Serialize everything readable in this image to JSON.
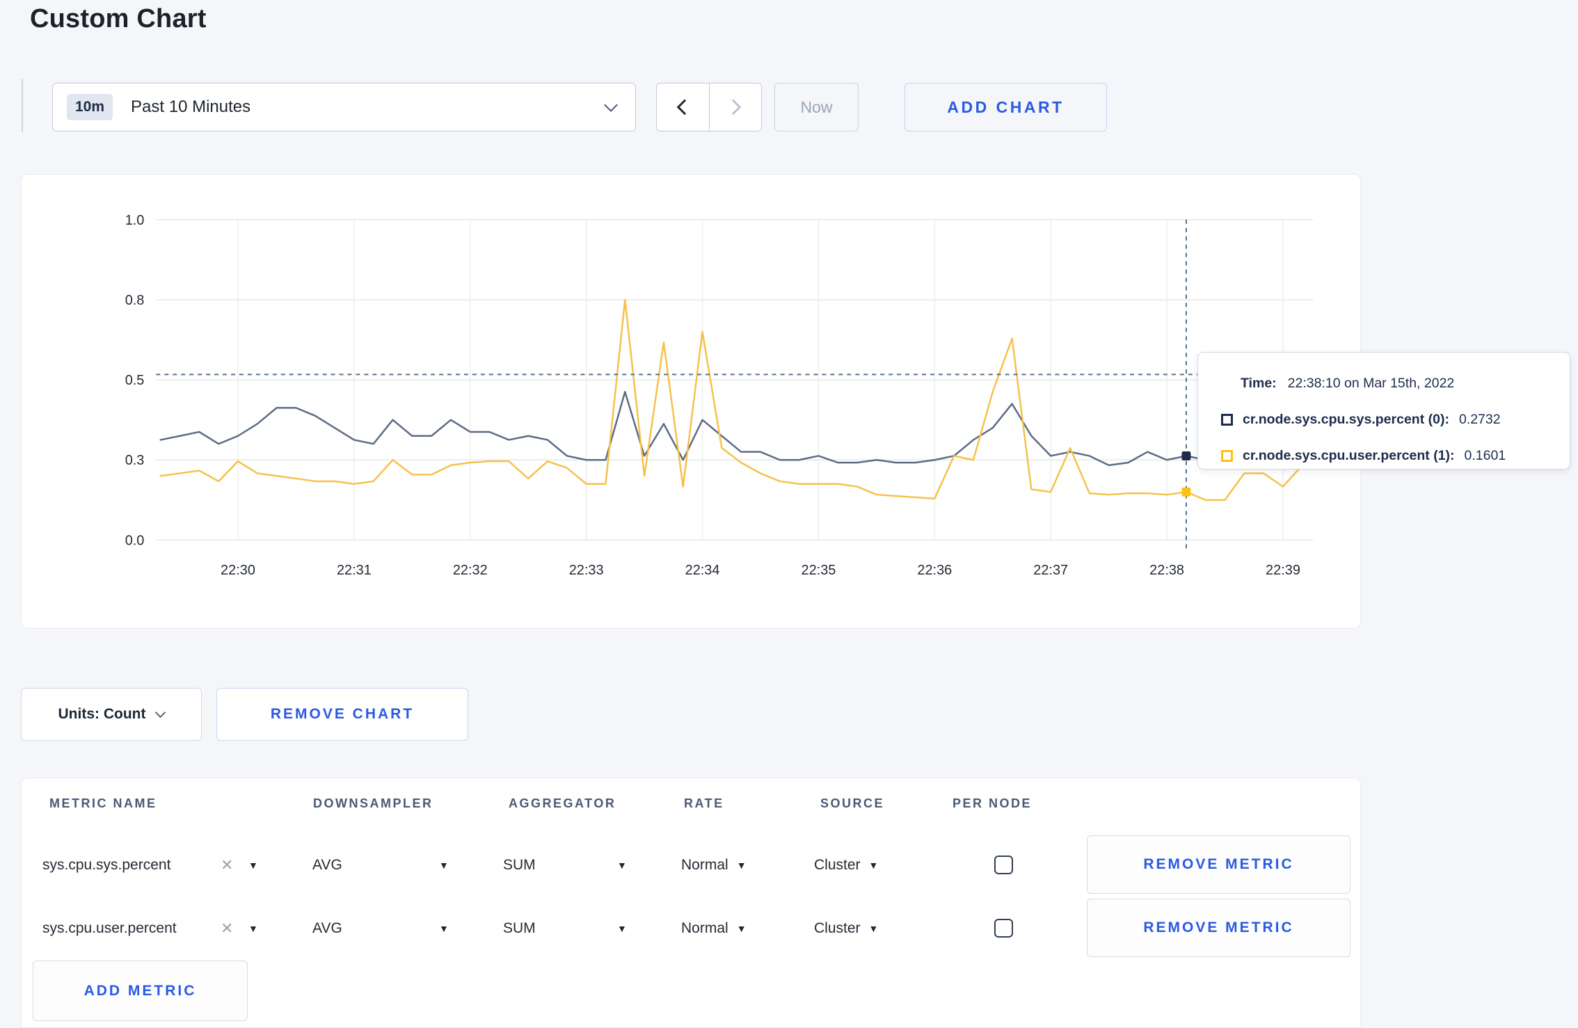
{
  "page": {
    "title": "Custom Chart"
  },
  "toolbar": {
    "time_range": {
      "badge": "10m",
      "label": "Past 10 Minutes"
    },
    "now_label": "Now",
    "add_chart_label": "ADD CHART"
  },
  "chart_data": {
    "type": "line",
    "title": "",
    "xlabel": "",
    "ylabel": "",
    "ylim": [
      0,
      1.0
    ],
    "grid": true,
    "x_start": "22:29:20",
    "x_end": "22:39:10",
    "x_interval_seconds": 10,
    "x_axis_ticks": [
      "22:30",
      "22:31",
      "22:32",
      "22:33",
      "22:34",
      "22:35",
      "22:36",
      "22:37",
      "22:38",
      "22:39"
    ],
    "y_axis_ticks": [
      0.0,
      0.3,
      0.5,
      0.8,
      1.0
    ],
    "y_tick_labels": [
      "0.0",
      "0.3",
      "0.5",
      "0.8",
      "1.0"
    ],
    "series": [
      {
        "name": "cr.node.sys.cpu.sys.percent (0)",
        "color": "#5d6b86",
        "marker_color": "#1d2c4c",
        "values": [
          0.35,
          0.36,
          0.37,
          0.34,
          0.36,
          0.39,
          0.43,
          0.43,
          0.41,
          0.38,
          0.35,
          0.34,
          0.4,
          0.36,
          0.36,
          0.4,
          0.37,
          0.37,
          0.35,
          0.36,
          0.35,
          0.31,
          0.3,
          0.3,
          0.47,
          0.31,
          0.39,
          0.3,
          0.4,
          0.36,
          0.32,
          0.32,
          0.3,
          0.3,
          0.31,
          0.29,
          0.29,
          0.3,
          0.29,
          0.29,
          0.3,
          0.31,
          0.35,
          0.38,
          0.44,
          0.36,
          0.31,
          0.32,
          0.31,
          0.28,
          0.29,
          0.32,
          0.3,
          0.31,
          0.3,
          0.3,
          0.31,
          0.3,
          0.31,
          0.3
        ]
      },
      {
        "name": "cr.node.sys.cpu.user.percent (1)",
        "color": "#f6c14b",
        "marker_color": "#ffc115",
        "values": [
          0.24,
          0.25,
          0.26,
          0.22,
          0.295,
          0.25,
          0.24,
          0.23,
          0.22,
          0.22,
          0.21,
          0.22,
          0.3,
          0.245,
          0.245,
          0.28,
          0.29,
          0.295,
          0.295,
          0.23,
          0.295,
          0.27,
          0.21,
          0.21,
          0.8,
          0.24,
          0.64,
          0.2,
          0.68,
          0.33,
          0.29,
          0.25,
          0.22,
          0.21,
          0.21,
          0.21,
          0.2,
          0.17,
          0.165,
          0.16,
          0.155,
          0.31,
          0.3,
          0.47,
          0.655,
          0.19,
          0.18,
          0.33,
          0.175,
          0.17,
          0.175,
          0.175,
          0.17,
          0.18,
          0.15,
          0.15,
          0.25,
          0.25,
          0.2,
          0.28
        ]
      }
    ],
    "crosshair": {
      "time": "22:38:10",
      "hline_value": 0.52
    }
  },
  "tooltip": {
    "time_label": "Time:",
    "time_value": "22:38:10 on Mar 15th, 2022",
    "entries": [
      {
        "label": "cr.node.sys.cpu.sys.percent (0):",
        "value": "0.2732",
        "color": "#1d2c4c"
      },
      {
        "label": "cr.node.sys.cpu.user.percent (1):",
        "value": "0.1601",
        "color": "#ffc115"
      }
    ]
  },
  "units_bar": {
    "units_label": "Units: Count",
    "remove_chart_label": "REMOVE CHART"
  },
  "metrics_table": {
    "headers": [
      "METRIC NAME",
      "DOWNSAMPLER",
      "AGGREGATOR",
      "RATE",
      "SOURCE",
      "PER NODE"
    ],
    "clear_symbol": "✕",
    "caret_symbol": "▼",
    "rows": [
      {
        "metric": "sys.cpu.sys.percent",
        "downsampler": "AVG",
        "aggregator": "SUM",
        "rate": "Normal",
        "source": "Cluster",
        "per_node_checked": false,
        "remove_label": "REMOVE METRIC"
      },
      {
        "metric": "sys.cpu.user.percent",
        "downsampler": "AVG",
        "aggregator": "SUM",
        "rate": "Normal",
        "source": "Cluster",
        "per_node_checked": false,
        "remove_label": "REMOVE METRIC"
      }
    ],
    "add_metric_label": "ADD METRIC"
  }
}
